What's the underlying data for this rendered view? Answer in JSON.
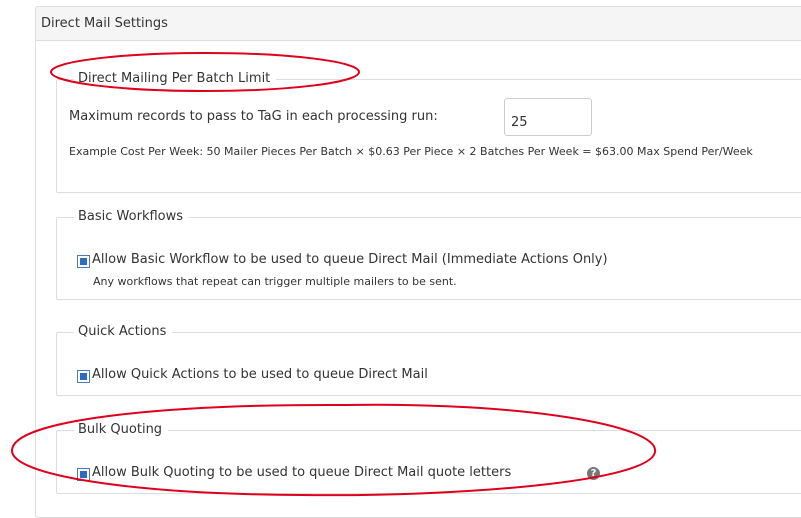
{
  "panel": {
    "title": "Direct Mail Settings"
  },
  "batch_limit": {
    "legend": "Direct Mailing Per Batch Limit",
    "max_records_label": "Maximum records to pass to TaG in each processing run:",
    "max_records_value": "25",
    "example_cost_text": "Example Cost Per Week: 50 Mailer Pieces Per Batch × $0.63 Per Piece × 2 Batches Per Week = $63.00 Max Spend Per/Week"
  },
  "basic_workflows": {
    "legend": "Basic Workflows",
    "checkbox_label": "Allow Basic Workflow to be used to queue Direct Mail (Immediate Actions Only)",
    "checked": true,
    "note": "Any workflows that repeat can trigger multiple mailers to be sent."
  },
  "quick_actions": {
    "legend": "Quick Actions",
    "checkbox_label": "Allow Quick Actions to be used to queue Direct Mail",
    "checked": true
  },
  "bulk_quoting": {
    "legend": "Bulk Quoting",
    "checkbox_label": "Allow Bulk Quoting to be used to queue Direct Mail quote letters",
    "checked": true,
    "help_icon": "question-circle-icon"
  },
  "annotation_color": "#e0001b"
}
